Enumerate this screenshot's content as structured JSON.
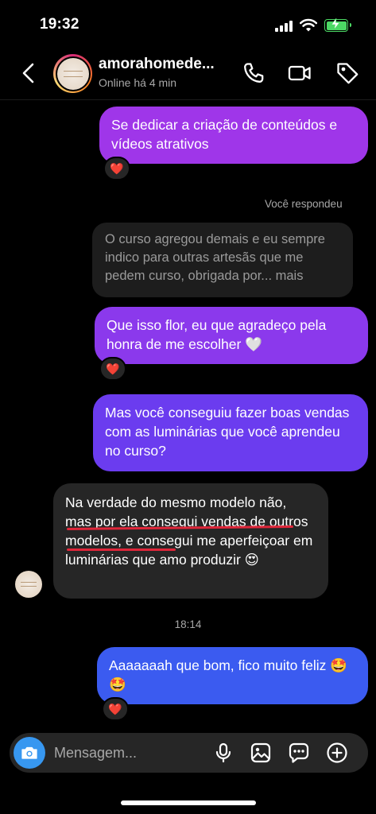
{
  "status_bar": {
    "time": "19:32"
  },
  "header": {
    "contact_name": "amorahomede...",
    "contact_status": "Online há 4 min"
  },
  "messages": [
    {
      "text": "Se dedicar a criação de conteúdos e vídeos atrativos",
      "reaction": "❤️"
    },
    {
      "reply_meta": "Você respondeu"
    },
    {
      "text": "O curso agregou demais e eu sempre indico para outras artesãs  que me pedem curso, obrigada por... mais"
    },
    {
      "text": "Que isso flor, eu que agradeço pela honra de me escolher 🤍",
      "reaction": "❤️"
    },
    {
      "text": "Mas você conseguiu fazer boas vendas com as luminárias que você aprendeu no curso?"
    },
    {
      "text": "Na verdade do mesmo modelo não, mas por ela consegui vendas de outros modelos, e consegui me aperfeiçoar em luminárias que amo produzir 😍"
    },
    {
      "timestamp": "18:14"
    },
    {
      "text": "Aaaaaaah que bom, fico muito feliz 🤩🤩",
      "reaction": "❤️"
    }
  ],
  "composer": {
    "placeholder": "Mensagem..."
  },
  "colors": {
    "background": "#000000",
    "incoming_bubble": "#262626",
    "outgoing_top": "#a233e8",
    "outgoing_bottom": "#3b5bf0",
    "camera_button": "#3797f0",
    "underline": "#e0263a"
  },
  "icons": [
    "back-chevron-icon",
    "phone-icon",
    "video-icon",
    "tag-icon",
    "camera-icon",
    "microphone-icon",
    "image-icon",
    "sticker-icon",
    "plus-icon",
    "heart-icon"
  ]
}
